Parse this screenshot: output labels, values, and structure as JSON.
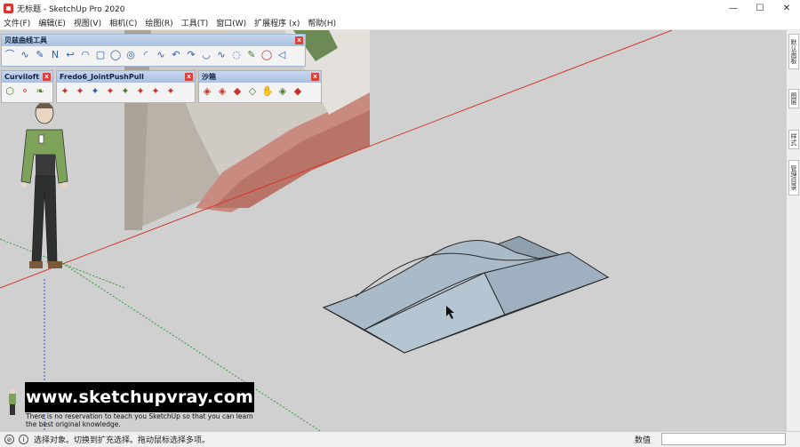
{
  "window": {
    "title": "无标题 - SketchUp Pro 2020",
    "controls": [
      "—",
      "☐",
      "✕"
    ]
  },
  "menu": [
    "文件(F)",
    "编辑(E)",
    "视图(V)",
    "相机(C)",
    "绘图(R)",
    "工具(T)",
    "窗口(W)",
    "扩展程序 (x)",
    "帮助(H)"
  ],
  "toolbars": {
    "bezier": {
      "title": "贝兹曲线工具",
      "close": "x",
      "tools": [
        "⌒",
        "∿",
        "✎",
        "Ν",
        "↩",
        "◠",
        "▢",
        "◯",
        "◎",
        "◜",
        "∿",
        "↶",
        "↷",
        "◡",
        "∿",
        "◌",
        "✎",
        "◯",
        "◁"
      ]
    },
    "curviloft": {
      "title": "Curviloft",
      "close": "x",
      "tools": [
        "⬡",
        "⚬",
        "❧"
      ]
    },
    "fredo": {
      "title": "Fredo6_JointPushPull",
      "close": "x",
      "tools": [
        "✦",
        "✦",
        "✦",
        "✦",
        "✦",
        "✦",
        "✦",
        "✦"
      ]
    },
    "sandbox": {
      "title": "沙箱",
      "close": "x",
      "tools": [
        "◈",
        "◈",
        "◆",
        "◇",
        "✋",
        "◈",
        "◆"
      ]
    }
  },
  "tray": {
    "tabs": [
      "默认面板",
      "图层",
      "样式",
      "管理目录"
    ]
  },
  "watermark": {
    "url": "www.sketchupvray.com",
    "line1": "There is no reservation to teach you SketchUp so that you can learn",
    "line2": "the best original knowledge."
  },
  "status": {
    "message": "选择对象。切换到扩充选择。拖动鼠标选择多项。",
    "measurements_label": "数值",
    "measurements_value": ""
  },
  "colors": {
    "viewport_bg": "#d0d0d0",
    "surface": "#9fb0bf",
    "red_axis": "#d23a2a",
    "green_axis": "#2e9a3a",
    "blue_axis": "#2a4fd0"
  }
}
